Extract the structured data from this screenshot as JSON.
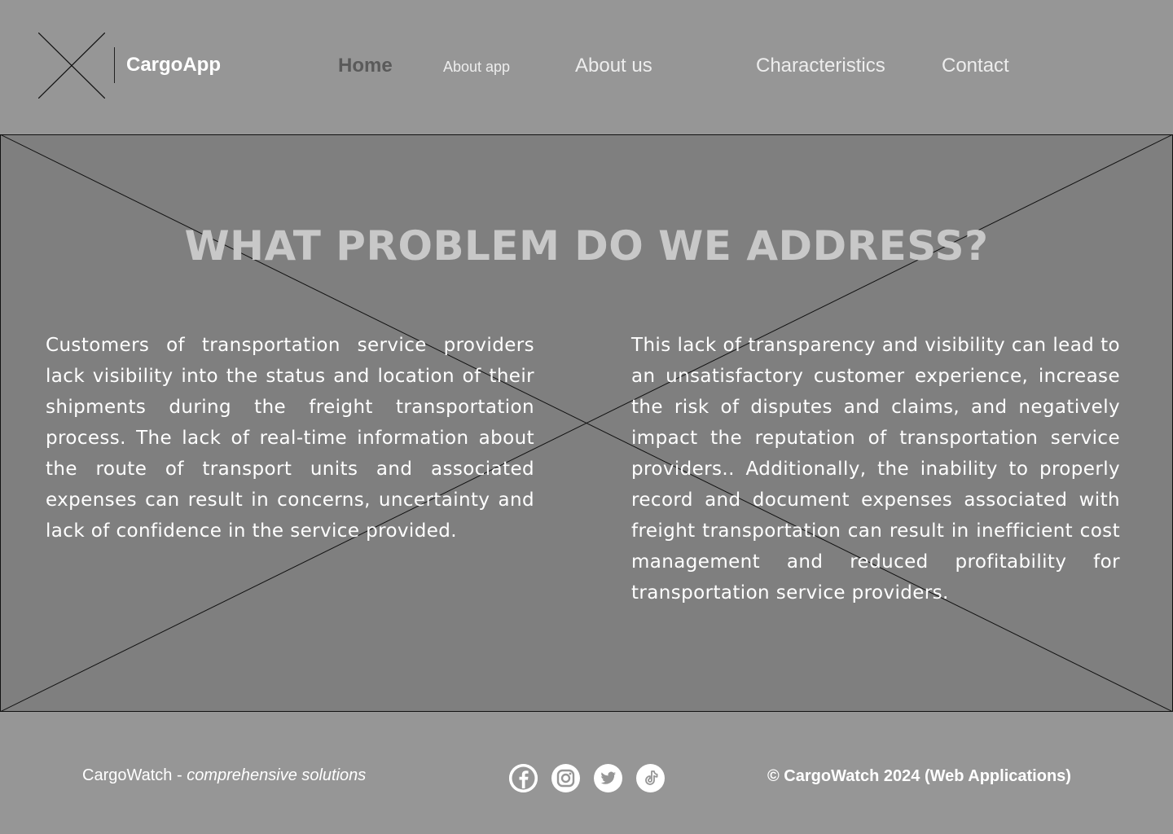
{
  "header": {
    "brand": "CargoApp",
    "logo_icon": "placeholder-x-icon",
    "nav": {
      "home": "Home",
      "about_app": "About app",
      "about_us": "About us",
      "characteristics": "Characteristics",
      "contact": "Contact"
    }
  },
  "hero": {
    "background_icon": "placeholder-x-icon",
    "title": "WHAT PROBLEM DO WE ADDRESS?",
    "left_text": "Customers of transportation service providers lack visibility into the status and location of their shipments during the freight transportation process. The lack of real-time information about the route of transport units and associated expenses can result in concerns, uncertainty and lack of confidence in the service provided.",
    "right_text": "This lack of transparency and visibility can lead to an unsatisfactory customer experience, increase the risk of disputes and claims, and negatively impact the reputation of transportation service providers.. Additionally, the inability to properly record and document expenses associated with freight transportation can result in inefficient cost management and reduced profitability for transportation service providers."
  },
  "footer": {
    "tagline_brand": "CargoWatch - ",
    "tagline_italic": "comprehensive solutions",
    "copyright": "© CargoWatch 2024 (Web Applications)",
    "socials": [
      "facebook-icon",
      "instagram-icon",
      "twitter-icon",
      "tiktok-icon"
    ]
  },
  "colors": {
    "header_bg": "#969696",
    "hero_bg": "#7f7f7f",
    "title": "#c8c8c8",
    "nav_active": "#5a5a5a",
    "text": "#ffffff"
  }
}
